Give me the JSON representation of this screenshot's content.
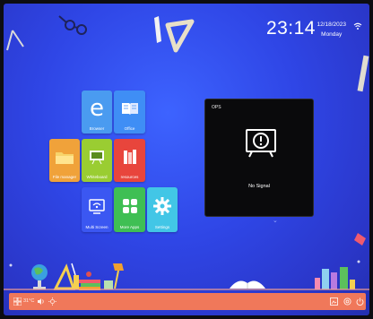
{
  "status_bar": {
    "time": "23:14",
    "date": "12/18/2023",
    "weekday": "Monday"
  },
  "apps": [
    {
      "label": "Browser",
      "color": "#4a9bf0",
      "icon": "browser-e-icon"
    },
    {
      "label": "Office",
      "color": "#3f8ef5",
      "icon": "book-icon"
    },
    {
      "label": "File manager",
      "color": "#f0a23a",
      "icon": "folder-icon"
    },
    {
      "label": "Whiteboard",
      "color": "#9acd32",
      "icon": "whiteboard-icon"
    },
    {
      "label": "resources",
      "color": "#e8453c",
      "icon": "books-icon"
    },
    {
      "label": "Multi Screen",
      "color": "#3b57f2",
      "icon": "wifi-screen-icon"
    },
    {
      "label": "More Apps",
      "color": "#3fbf54",
      "icon": "grid-icon"
    },
    {
      "label": "Settings",
      "color": "#42c6e6",
      "icon": "gear-icon"
    }
  ],
  "ops_panel": {
    "source": "OPS",
    "message": "No Signal"
  },
  "taskbar": {
    "temperature": "31°C"
  }
}
